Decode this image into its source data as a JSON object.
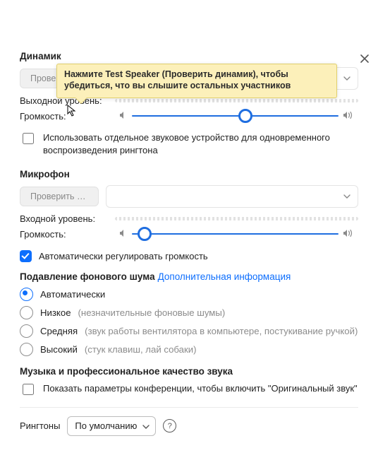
{
  "tooltip": "Нажмите Test Speaker (Проверить динамик), чтобы убедиться, что вы слышите остальных участников",
  "speaker": {
    "heading": "Динамик",
    "test_label": "Проверить ди…",
    "output_label": "Выходной уровень:",
    "volume_label": "Громкость:",
    "volume_percent": 55,
    "ringtone_checkbox": "Использовать отдельное звуковое устройство для одновременного воспроизведения рингтона"
  },
  "mic": {
    "heading": "Микрофон",
    "test_label": "Проверить м…",
    "input_label": "Входной уровень:",
    "volume_label": "Громкость:",
    "volume_percent": 6,
    "auto_adjust": "Автоматически регулировать громкость"
  },
  "noise": {
    "heading": "Подавление фонового шума",
    "link": "Дополнительная информация",
    "options": [
      {
        "label": "Автоматически",
        "hint": "",
        "checked": true
      },
      {
        "label": "Низкое",
        "hint": "(незначительные фоновые шумы)",
        "checked": false
      },
      {
        "label": "Средняя",
        "hint": "(звук работы вентилятора в компьютере, постукивание ручкой)",
        "checked": false
      },
      {
        "label": "Высокий",
        "hint": "(стук клавиш, лай собаки)",
        "checked": false
      }
    ]
  },
  "music": {
    "heading": "Музыка и профессиональное качество звука",
    "checkbox": "Показать параметры конференции, чтобы включить \"Оригинальный звук\""
  },
  "ringtones": {
    "label": "Рингтоны",
    "selected": "По умолчанию"
  }
}
